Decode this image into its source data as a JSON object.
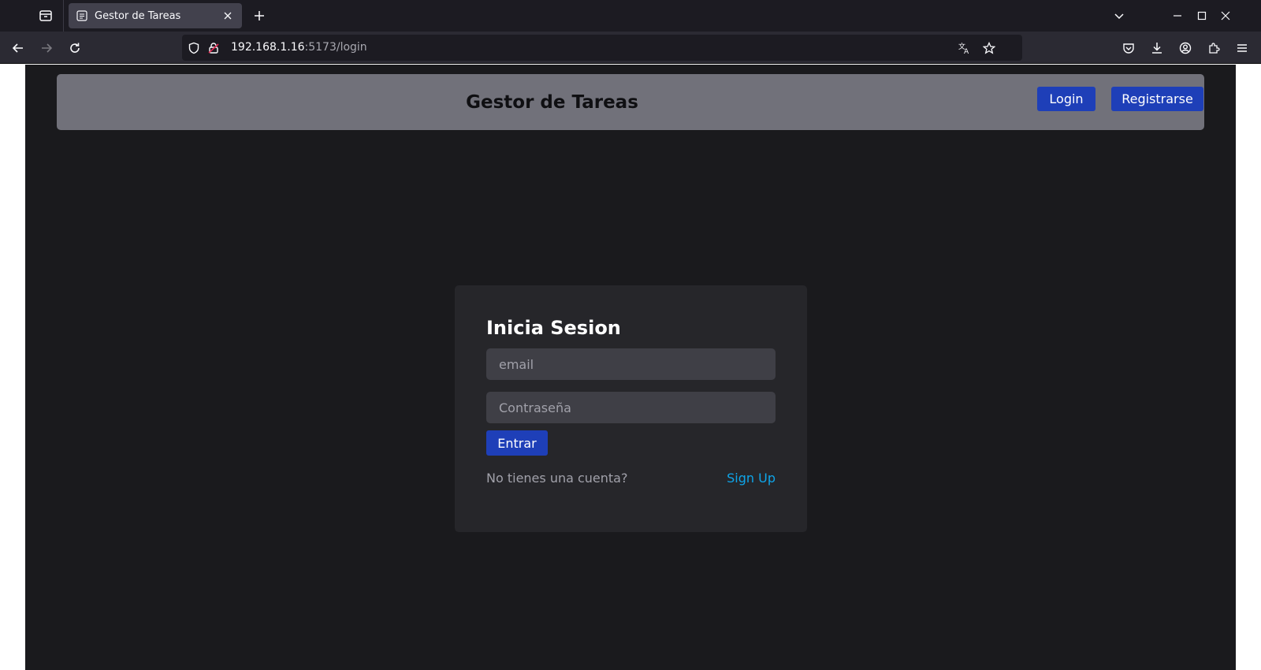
{
  "browser": {
    "tab_title": "Gestor de Tareas",
    "url_host": "192.168.1.16",
    "url_rest": ":5173/login"
  },
  "header": {
    "title": "Gestor de Tareas",
    "login_label": "Login",
    "register_label": "Registrarse"
  },
  "login_card": {
    "title": "Inicia Sesion",
    "email_placeholder": "email",
    "password_placeholder": "Contraseña",
    "submit_label": "Entrar",
    "no_account_text": "No tienes una cuenta?",
    "signup_link": "Sign Up"
  },
  "colors": {
    "page_bg": "#1a1a1d",
    "header_bg": "#71717a",
    "card_bg": "#26262a",
    "input_bg": "#3f3f46",
    "primary_button": "#1e3fb8",
    "link": "#0ea5e9"
  }
}
